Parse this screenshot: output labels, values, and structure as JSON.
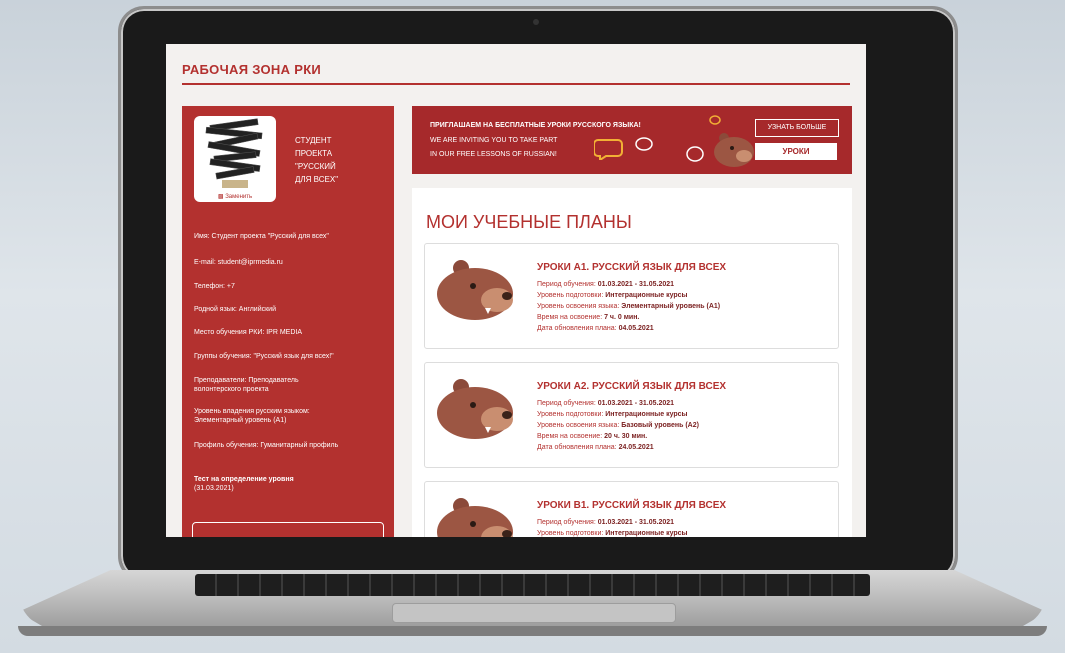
{
  "page": {
    "title": "РАБОЧАЯ ЗОНА РКИ"
  },
  "sidebar": {
    "avatar_change_label": "Заменить",
    "role_lines": [
      "СТУДЕНТ",
      "ПРОЕКТА",
      "\"РУССКИЙ",
      "ДЛЯ ВСЕХ\""
    ],
    "name": "Имя: Студент проекта \"Русский для всех\"",
    "email": "E-mail: student@iprmedia.ru",
    "phone": "Телефон: +7",
    "native_language": "Родной язык: Английский",
    "study_place": "Место обучения РКИ: IPR MEDIA",
    "groups": "Группы обучения: \"Русский язык для всех!\"",
    "teachers": "Преподаватели: Преподаватель волонтерского проекта",
    "level": "Уровень владения русским языком: Элементарный уровень (А1)",
    "profile": "Профиль обучения: Гуманитарный профиль",
    "test_label": "Тест на определение уровня",
    "test_date": "(31.03.2021)"
  },
  "banner": {
    "title": "ПРИГЛАШАЕМ НА БЕСПЛАТНЫЕ УРОКИ РУССКОГО ЯЗЫКА!",
    "sub1": "WE ARE INVITING YOU TO TAKE PART",
    "sub2": "IN OUR FREE LESSONS OF RUSSIAN!",
    "learn_more": "УЗНАТЬ БОЛЬШЕ",
    "lessons": "УРОКИ"
  },
  "plans": {
    "heading": "МОИ УЧЕБНЫЕ ПЛАНЫ",
    "items": [
      {
        "title": "УРОКИ А1. РУССКИЙ ЯЗЫК ДЛЯ ВСЕХ",
        "period_label": "Период обучения: ",
        "period": "01.03.2021 - 31.05.2021",
        "prep_label": "Уровень подготовки: ",
        "prep": "Интеграционные курсы",
        "level_label": "Уровень освоения языка: ",
        "level": "Элементарный уровень (А1)",
        "time_label": "Время на освоение: ",
        "time": "7 ч. 0 мин.",
        "updated_label": "Дата обновления плана: ",
        "updated": "04.05.2021"
      },
      {
        "title": "УРОКИ А2. РУССКИЙ ЯЗЫК ДЛЯ ВСЕХ",
        "period_label": "Период обучения: ",
        "period": "01.03.2021 - 31.05.2021",
        "prep_label": "Уровень подготовки: ",
        "prep": "Интеграционные курсы",
        "level_label": "Уровень освоения языка: ",
        "level": "Базовый уровень (А2)",
        "time_label": "Время на освоение: ",
        "time": "20 ч. 30 мин.",
        "updated_label": "Дата обновления плана: ",
        "updated": "24.05.2021"
      },
      {
        "title": "УРОКИ В1. РУССКИЙ ЯЗЫК ДЛЯ ВСЕХ",
        "period_label": "Период обучения: ",
        "period": "01.03.2021 - 31.05.2021",
        "prep_label": "Уровень подготовки: ",
        "prep": "Интеграционные курсы"
      }
    ]
  },
  "colors": {
    "brand": "#b3312f",
    "banner": "#a6292b",
    "bear": "#8b4a3a"
  }
}
